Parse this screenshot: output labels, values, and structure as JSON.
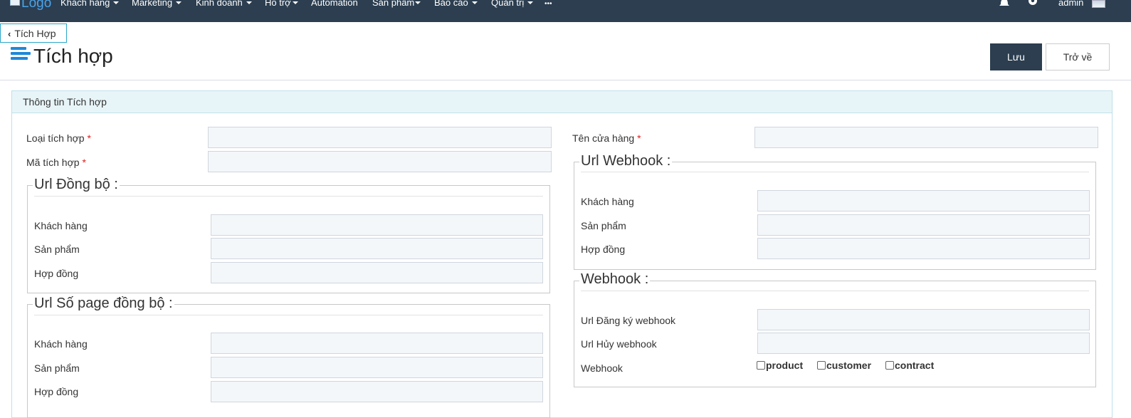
{
  "nav": {
    "logo_text": "Logo",
    "items": [
      {
        "label": "Khách hàng",
        "dropdown": true
      },
      {
        "label": "Marketing",
        "dropdown": true
      },
      {
        "label": "Kinh doanh",
        "dropdown": true
      },
      {
        "label": "Hỗ trợ",
        "dropdown": true
      },
      {
        "label": "Automation",
        "dropdown": false
      },
      {
        "label": "Sản phẩm",
        "dropdown": true
      },
      {
        "label": "Báo cáo",
        "dropdown": true
      },
      {
        "label": "Quản trị",
        "dropdown": true
      }
    ],
    "more_label": "•••",
    "user_label": "admin"
  },
  "breadcrumb": {
    "label": "Tích Hợp"
  },
  "page": {
    "title": "Tích hợp",
    "save_label": "Lưu",
    "back_label": "Trở về"
  },
  "panel": {
    "heading": "Thông tin Tích hợp",
    "integration_type_label": "Loại tích hợp",
    "integration_code_label": "Mã tích hợp",
    "store_name_label": "Tên cửa hàng",
    "required_mark": "*",
    "sync_url": {
      "legend": "Url Đồng bộ :",
      "customer_label": "Khách hàng",
      "product_label": "Sản phẩm",
      "contract_label": "Hợp đồng"
    },
    "sync_page_url": {
      "legend": "Url Số page đồng bộ :",
      "customer_label": "Khách hàng",
      "product_label": "Sản phẩm",
      "contract_label": "Hợp đồng"
    },
    "webhook_url": {
      "legend": "Url Webhook :",
      "customer_label": "Khách hàng",
      "product_label": "Sản phẩm",
      "contract_label": "Hợp đồng"
    },
    "webhook": {
      "legend": "Webhook :",
      "register_label": "Url Đăng ký webhook",
      "cancel_label": "Url Hủy webhook",
      "webhook_label": "Webhook",
      "options": [
        "product",
        "customer",
        "contract"
      ]
    }
  }
}
